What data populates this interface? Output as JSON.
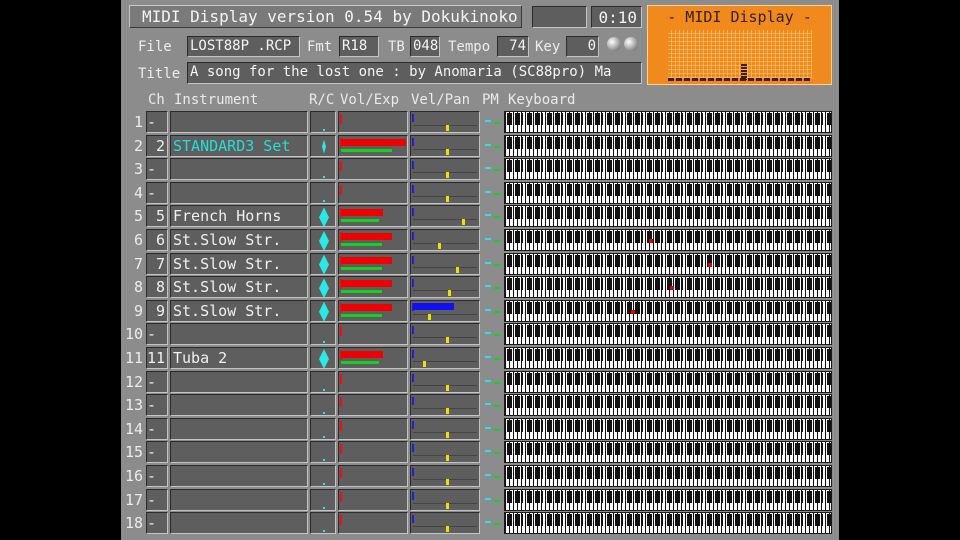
{
  "app": {
    "title": "MIDI Display  version 0.54  by Dokukinoko",
    "time": "0:10",
    "meter_title": "- MIDI Display -"
  },
  "file": {
    "file_label": "File",
    "file_value": "LOST88P .RCP",
    "fmt_label": "Fmt",
    "fmt_value": "R18",
    "tb_label": "TB",
    "tb_value": "048",
    "tempo_label": "Tempo",
    "tempo_value": "74",
    "key_label": "Key",
    "key_value": "0",
    "title_label": "Title",
    "title_value": "A song for the lost one : by Anomaria (SC88pro) Ma"
  },
  "headers": {
    "ch": "Ch",
    "instrument": "Instrument",
    "rc": "R/C",
    "vol_exp": "Vol/Exp",
    "vel_pan": "Vel/Pan",
    "pm": "PM",
    "keyboard": "Keyboard"
  },
  "channels": [
    {
      "num": "1",
      "ch": "--",
      "instrument": "",
      "rc": "dot",
      "vol": 0,
      "exp": 0,
      "vel": 0,
      "pan": 0.52,
      "note": null
    },
    {
      "num": "2",
      "ch": "2",
      "instrument": "STANDARD3 Set",
      "rc": "small",
      "vol": 0.98,
      "exp": 0.98,
      "vel": 0,
      "pan": 0.52,
      "note": null,
      "drum": true
    },
    {
      "num": "3",
      "ch": "--",
      "instrument": "",
      "rc": "dot",
      "vol": 0,
      "exp": 0,
      "vel": 0,
      "pan": 0.52,
      "note": null
    },
    {
      "num": "4",
      "ch": "--",
      "instrument": "",
      "rc": "dot",
      "vol": 0,
      "exp": 0,
      "vel": 0,
      "pan": 0.52,
      "note": null
    },
    {
      "num": "5",
      "ch": "5",
      "instrument": "French Horns",
      "rc": "big",
      "vol": 0.64,
      "exp": 0.74,
      "vel": 0,
      "pan": 0.77,
      "note": null
    },
    {
      "num": "6",
      "ch": "6",
      "instrument": "St.Slow Str.",
      "rc": "big",
      "vol": 0.78,
      "exp": 0.78,
      "vel": 0,
      "pan": 0.4,
      "note": 0.445
    },
    {
      "num": "7",
      "ch": "7",
      "instrument": "St.Slow Str.",
      "rc": "big",
      "vol": 0.78,
      "exp": 0.78,
      "vel": 0,
      "pan": 0.68,
      "note": 0.625
    },
    {
      "num": "8",
      "ch": "8",
      "instrument": "St.Slow Str.",
      "rc": "big",
      "vol": 0.78,
      "exp": 0.78,
      "vel": 0,
      "pan": 0.55,
      "note": 0.51
    },
    {
      "num": "9",
      "ch": "9",
      "instrument": "St.Slow Str.",
      "rc": "big",
      "vol": 0.78,
      "exp": 0.78,
      "vel": 0.62,
      "pan": 0.24,
      "note": 0.39
    },
    {
      "num": "10",
      "ch": "--",
      "instrument": "",
      "rc": "dot",
      "vol": 0,
      "exp": 0,
      "vel": 0,
      "pan": 0.52,
      "note": null
    },
    {
      "num": "11",
      "ch": "11",
      "instrument": "Tuba 2",
      "rc": "big",
      "vol": 0.64,
      "exp": 0.74,
      "vel": 0,
      "pan": 0.16,
      "note": null
    },
    {
      "num": "12",
      "ch": "--",
      "instrument": "",
      "rc": "dot",
      "vol": 0,
      "exp": 0,
      "vel": 0,
      "pan": 0.52,
      "note": null
    },
    {
      "num": "13",
      "ch": "--",
      "instrument": "",
      "rc": "dot",
      "vol": 0,
      "exp": 0,
      "vel": 0,
      "pan": 0.52,
      "note": null
    },
    {
      "num": "14",
      "ch": "--",
      "instrument": "",
      "rc": "dot",
      "vol": 0,
      "exp": 0,
      "vel": 0,
      "pan": 0.52,
      "note": null
    },
    {
      "num": "15",
      "ch": "--",
      "instrument": "",
      "rc": "dot",
      "vol": 0,
      "exp": 0,
      "vel": 0,
      "pan": 0.52,
      "note": null
    },
    {
      "num": "16",
      "ch": "--",
      "instrument": "",
      "rc": "dot",
      "vol": 0,
      "exp": 0,
      "vel": 0,
      "pan": 0.52,
      "note": null
    },
    {
      "num": "17",
      "ch": "--",
      "instrument": "",
      "rc": "dot",
      "vol": 0,
      "exp": 0,
      "vel": 0,
      "pan": 0.52,
      "note": null
    },
    {
      "num": "18",
      "ch": "--",
      "instrument": "",
      "rc": "dot",
      "vol": 0,
      "exp": 0,
      "vel": 0,
      "pan": 0.52,
      "note": null
    }
  ],
  "colors": {
    "panel": "#8c8c8c",
    "meter": "#f08a1c",
    "volume": "#f00000",
    "expression": "#14d020",
    "velocity": "#1010f0",
    "pan": "#f0e000",
    "drum_text": "#20e0d8",
    "note_on": "#e00000"
  }
}
